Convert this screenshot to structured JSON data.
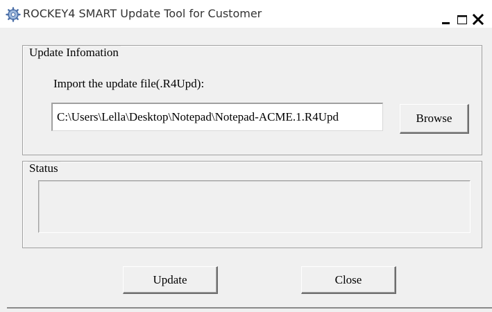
{
  "window": {
    "title": "ROCKEY4 SMART Update Tool for Customer",
    "icon": "app-gear-icon",
    "controls": {
      "minimize": "minimize-icon",
      "maximize": "maximize-icon",
      "close": "close-icon"
    }
  },
  "update_group": {
    "legend": "Update Infomation",
    "import_label": "Import the update file(.R4Upd):",
    "file_path": "C:\\Users\\Lella\\Desktop\\Notepad\\Notepad-ACME.1.R4Upd",
    "browse_label": "Browse"
  },
  "status_group": {
    "legend": "Status",
    "text": ""
  },
  "actions": {
    "update_label": "Update",
    "close_label": "Close"
  },
  "colors": {
    "face": "#f0f0f0",
    "shadow": "#a0a0a0",
    "dark_shadow": "#6e6e6e",
    "highlight": "#ffffff"
  }
}
